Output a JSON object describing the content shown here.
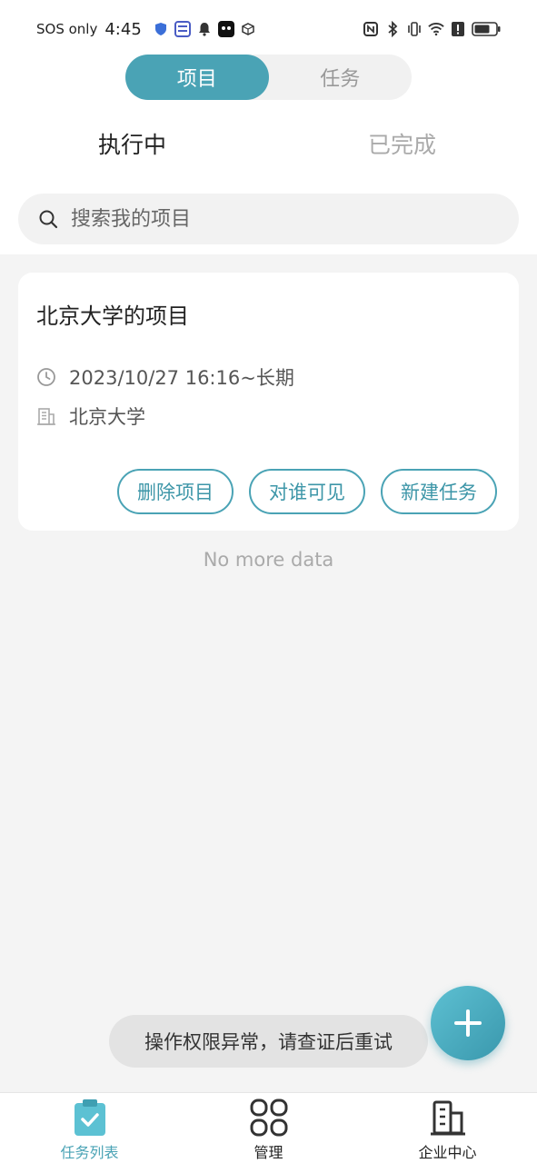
{
  "status_bar": {
    "carrier": "SOS only",
    "time": "4:45"
  },
  "segment": {
    "tabs": [
      {
        "label": "项目",
        "active": true
      },
      {
        "label": "任务",
        "active": false
      }
    ]
  },
  "subtabs": [
    {
      "label": "执行中",
      "active": true
    },
    {
      "label": "已完成",
      "active": false
    }
  ],
  "search": {
    "placeholder": "搜索我的项目"
  },
  "projects": [
    {
      "title": "北京大学的项目",
      "time": "2023/10/27 16:16~长期",
      "organization": "北京大学",
      "actions": [
        "删除项目",
        "对谁可见",
        "新建任务"
      ]
    }
  ],
  "list_end_text": "No more data",
  "toast": "操作权限异常，请查证后重试",
  "bottom_nav": [
    {
      "label": "任务列表",
      "icon": "clipboard-check-icon",
      "active": true
    },
    {
      "label": "管理",
      "icon": "grid-icon",
      "active": false
    },
    {
      "label": "企业中心",
      "icon": "building-icon",
      "active": false
    }
  ],
  "colors": {
    "accent": "#4aa3b5",
    "background": "#f4f4f4"
  }
}
